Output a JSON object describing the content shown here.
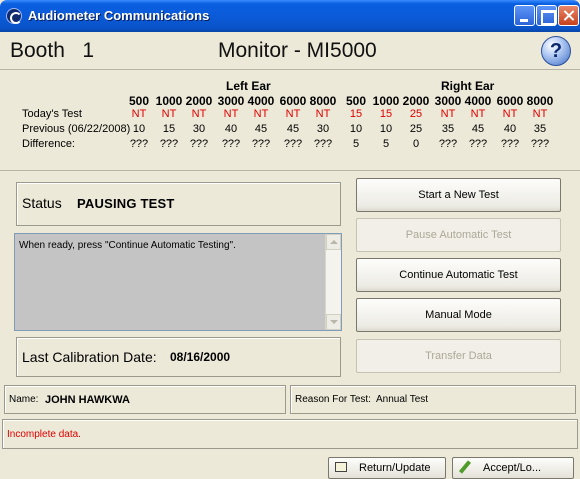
{
  "window": {
    "title": "Audiometer Communications"
  },
  "header": {
    "booth_label": "Booth   1",
    "monitor_label": "Monitor - MI5000",
    "help_glyph": "?"
  },
  "audiogram": {
    "left_ear_label": "Left Ear",
    "right_ear_label": "Right Ear",
    "frequencies": [
      "500",
      "1000",
      "2000",
      "3000",
      "4000",
      "6000",
      "8000"
    ],
    "rows": [
      {
        "label": "Today's Test",
        "left": [
          "NT",
          "NT",
          "NT",
          "NT",
          "NT",
          "NT",
          "NT"
        ],
        "right": [
          "15",
          "15",
          "25",
          "NT",
          "NT",
          "NT",
          "NT"
        ]
      },
      {
        "label": "Previous (06/22/2008)",
        "left": [
          "10",
          "15",
          "30",
          "40",
          "45",
          "45",
          "30"
        ],
        "right": [
          "10",
          "10",
          "25",
          "35",
          "45",
          "40",
          "35"
        ]
      },
      {
        "label": "Difference:",
        "left": [
          "???",
          "???",
          "???",
          "???",
          "???",
          "???",
          "???"
        ],
        "right": [
          "5",
          "5",
          "0",
          "???",
          "???",
          "???",
          "???"
        ]
      }
    ],
    "colors": {
      "today": "#e00000"
    }
  },
  "status": {
    "label": "Status",
    "value": "PAUSING TEST"
  },
  "message": {
    "text": "When ready, press \"Continue Automatic Testing\"."
  },
  "calibration": {
    "label": "Last Calibration Date:",
    "value": "08/16/2000"
  },
  "buttons": {
    "start": "Start a New Test",
    "pause": "Pause Automatic Test",
    "continue": "Continue Automatic Test",
    "manual": "Manual Mode",
    "transfer": "Transfer Data"
  },
  "patient": {
    "name_label": "Name:",
    "name_value": "JOHN HAWKWA",
    "reason_label": "Reason For Test:",
    "reason_value": "Annual Test"
  },
  "error": {
    "text": "Incomplete data."
  },
  "bottom": {
    "return_label": "Return/Update",
    "accept_label": "Accept/Lo..."
  }
}
